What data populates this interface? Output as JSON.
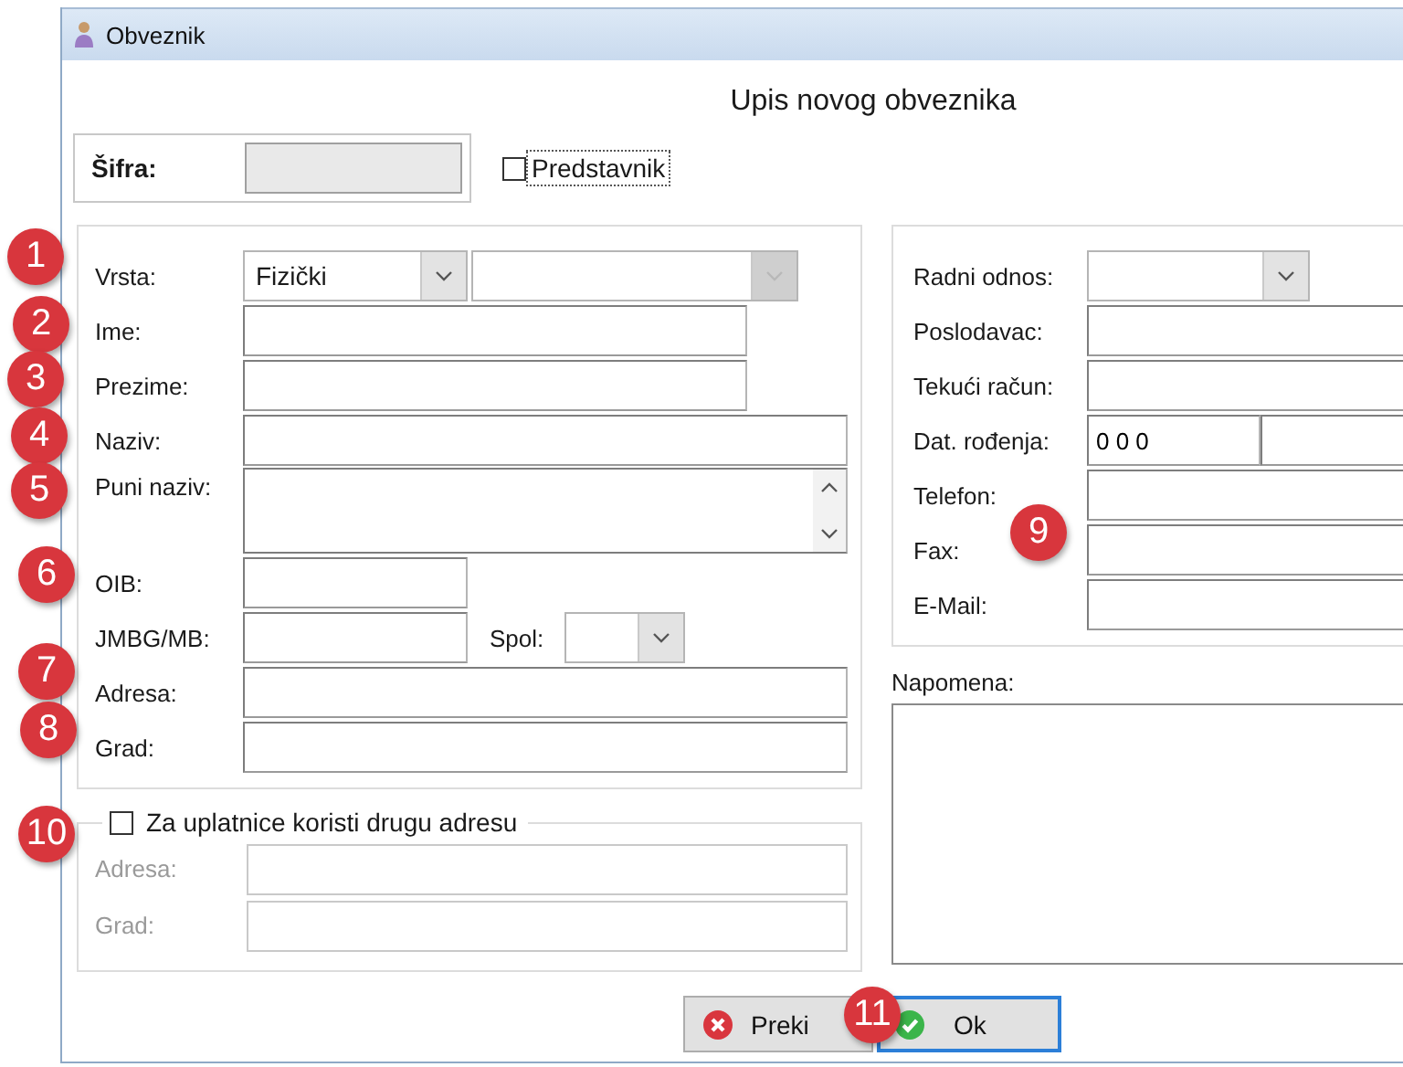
{
  "window": {
    "title": "Obveznik"
  },
  "heading": "Upis novog obveznika",
  "sifra": {
    "label": "Šifra:",
    "disabled": true
  },
  "predstavnik": {
    "label": "Predstavnik",
    "checked": false,
    "focused": true
  },
  "left_fields": [
    {
      "kind": "combo-pair",
      "label": "Vrsta:",
      "value": "Fizički",
      "second_disabled": true
    },
    {
      "kind": "text",
      "label": "Ime:"
    },
    {
      "kind": "text",
      "label": "Prezime:"
    },
    {
      "kind": "text",
      "label": "Naziv:"
    },
    {
      "kind": "memo",
      "label": "Puni naziv:"
    },
    {
      "kind": "text",
      "label": "OIB:"
    },
    {
      "kind": "text-combo",
      "label": "JMBG/MB:",
      "extra_label": "Spol:"
    },
    {
      "kind": "text",
      "label": "Adresa:"
    },
    {
      "kind": "text",
      "label": "Grad:"
    }
  ],
  "right_fields": [
    {
      "kind": "combo",
      "label": "Radni odnos:"
    },
    {
      "kind": "text",
      "label": "Poslodavac:"
    },
    {
      "kind": "text",
      "label": "Tekući račun:"
    },
    {
      "kind": "date",
      "label": "Dat. rođenja:",
      "value": "0 0 0"
    },
    {
      "kind": "text",
      "label": "Telefon:"
    },
    {
      "kind": "text",
      "label": "Fax:"
    },
    {
      "kind": "text",
      "label": "E-Mail:"
    }
  ],
  "alt_address": {
    "label": "Za uplatnice koristi drugu adresu",
    "checked": false,
    "fields": [
      {
        "label": "Adresa:"
      },
      {
        "label": "Grad:"
      }
    ]
  },
  "napomena": {
    "label": "Napomena:"
  },
  "buttons": [
    {
      "kind": "cancel",
      "label": "Preki",
      "focused": false
    },
    {
      "kind": "ok",
      "label": "Ok",
      "focused": true
    }
  ],
  "badges": [
    "1",
    "2",
    "3",
    "4",
    "5",
    "6",
    "7",
    "8",
    "9",
    "10",
    "11"
  ]
}
